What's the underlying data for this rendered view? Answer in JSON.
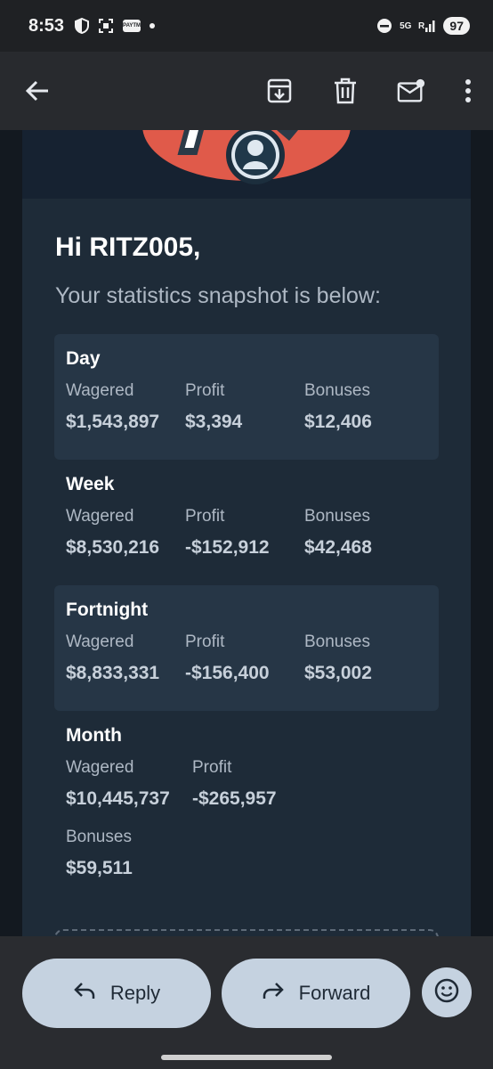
{
  "status_bar": {
    "time": "8:53",
    "network": "5G",
    "battery": "97",
    "paytm": "PAYTM"
  },
  "app_bar": {
    "icons": [
      "arrow-back-icon",
      "archive-icon",
      "delete-icon",
      "mark-unread-icon",
      "more-vert-icon"
    ]
  },
  "email": {
    "greeting": "Hi RITZ005,",
    "subline": "Your statistics snapshot is below:",
    "periods": [
      {
        "title": "Day",
        "wagered_label": "Wagered",
        "wagered": "$1,543,897",
        "profit_label": "Profit",
        "profit": "$3,394",
        "bonuses_label": "Bonuses",
        "bonuses": "$12,406"
      },
      {
        "title": "Week",
        "wagered_label": "Wagered",
        "wagered": "$8,530,216",
        "profit_label": "Profit",
        "profit": "-$152,912",
        "bonuses_label": "Bonuses",
        "bonuses": "$42,468"
      },
      {
        "title": "Fortnight",
        "wagered_label": "Wagered",
        "wagered": "$8,833,331",
        "profit_label": "Profit",
        "profit": "-$156,400",
        "bonuses_label": "Bonuses",
        "bonuses": "$53,002"
      },
      {
        "title": "Month",
        "wagered_label": "Wagered",
        "wagered": "$10,445,737",
        "profit_label": "Profit",
        "profit": "-$265,957",
        "bonuses_label": "Bonuses",
        "bonuses": "$59,511"
      }
    ]
  },
  "bottom_bar": {
    "reply_label": "Reply",
    "forward_label": "Forward"
  },
  "colors": {
    "accent": "#e05a4a",
    "button_bg": "#c5d2e0"
  }
}
